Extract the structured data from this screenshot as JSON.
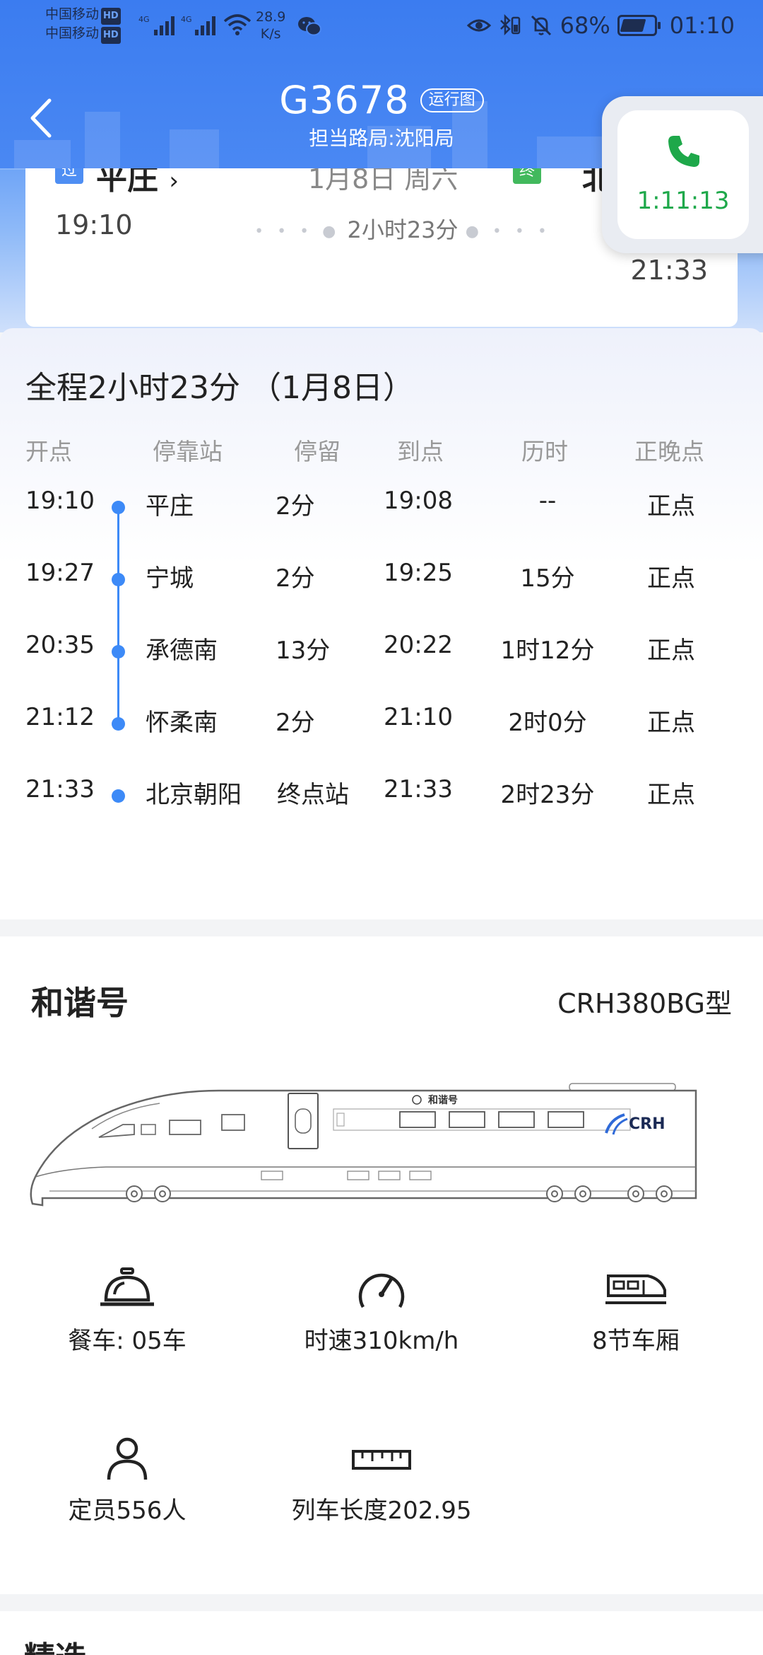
{
  "status_bar": {
    "carrier1": "中国移动",
    "carrier2": "中国移动",
    "hd": "HD",
    "net_speed": "28.9",
    "net_unit": "K/s",
    "battery": "68%",
    "time": "01:10"
  },
  "header": {
    "train_no": "G3678",
    "map_tag": "运行图",
    "bureau": "担当路局:沈阳局"
  },
  "summary": {
    "pass_tag": "过",
    "from": "平庄",
    "from_arrow": "›",
    "date": "1月8日 周六",
    "end_tag": "终",
    "to": "北",
    "dep_time": "19:10",
    "duration": "2小时23分",
    "arr_time": "21:33"
  },
  "call": {
    "timer": "1:11:13"
  },
  "timetable": {
    "title": "全程2小时23分 （1月8日）",
    "headers": [
      "开点",
      "停靠站",
      "停留",
      "到点",
      "历时",
      "正晚点"
    ],
    "rows": [
      {
        "dep": "19:10",
        "station": "平庄",
        "stay": "2分",
        "arr": "19:08",
        "elapsed": "--",
        "status": "正点"
      },
      {
        "dep": "19:27",
        "station": "宁城",
        "stay": "2分",
        "arr": "19:25",
        "elapsed": "15分",
        "status": "正点"
      },
      {
        "dep": "20:35",
        "station": "承德南",
        "stay": "13分",
        "arr": "20:22",
        "elapsed": "1时12分",
        "status": "正点"
      },
      {
        "dep": "21:12",
        "station": "怀柔南",
        "stay": "2分",
        "arr": "21:10",
        "elapsed": "2时0分",
        "status": "正点"
      },
      {
        "dep": "21:33",
        "station": "北京朝阳",
        "stay": "终点站",
        "arr": "21:33",
        "elapsed": "2时23分",
        "status": "正点"
      }
    ]
  },
  "train_info": {
    "name": "和谐号",
    "model": "CRH380BG型",
    "body_logo": "和谐号",
    "crh": "CRH",
    "features": {
      "dining": "餐车: 05车",
      "speed": "时速310km/h",
      "cars": "8节车厢",
      "capacity": "定员556人",
      "length": "列车长度202.95"
    }
  },
  "bottom": {
    "title": "精选"
  }
}
